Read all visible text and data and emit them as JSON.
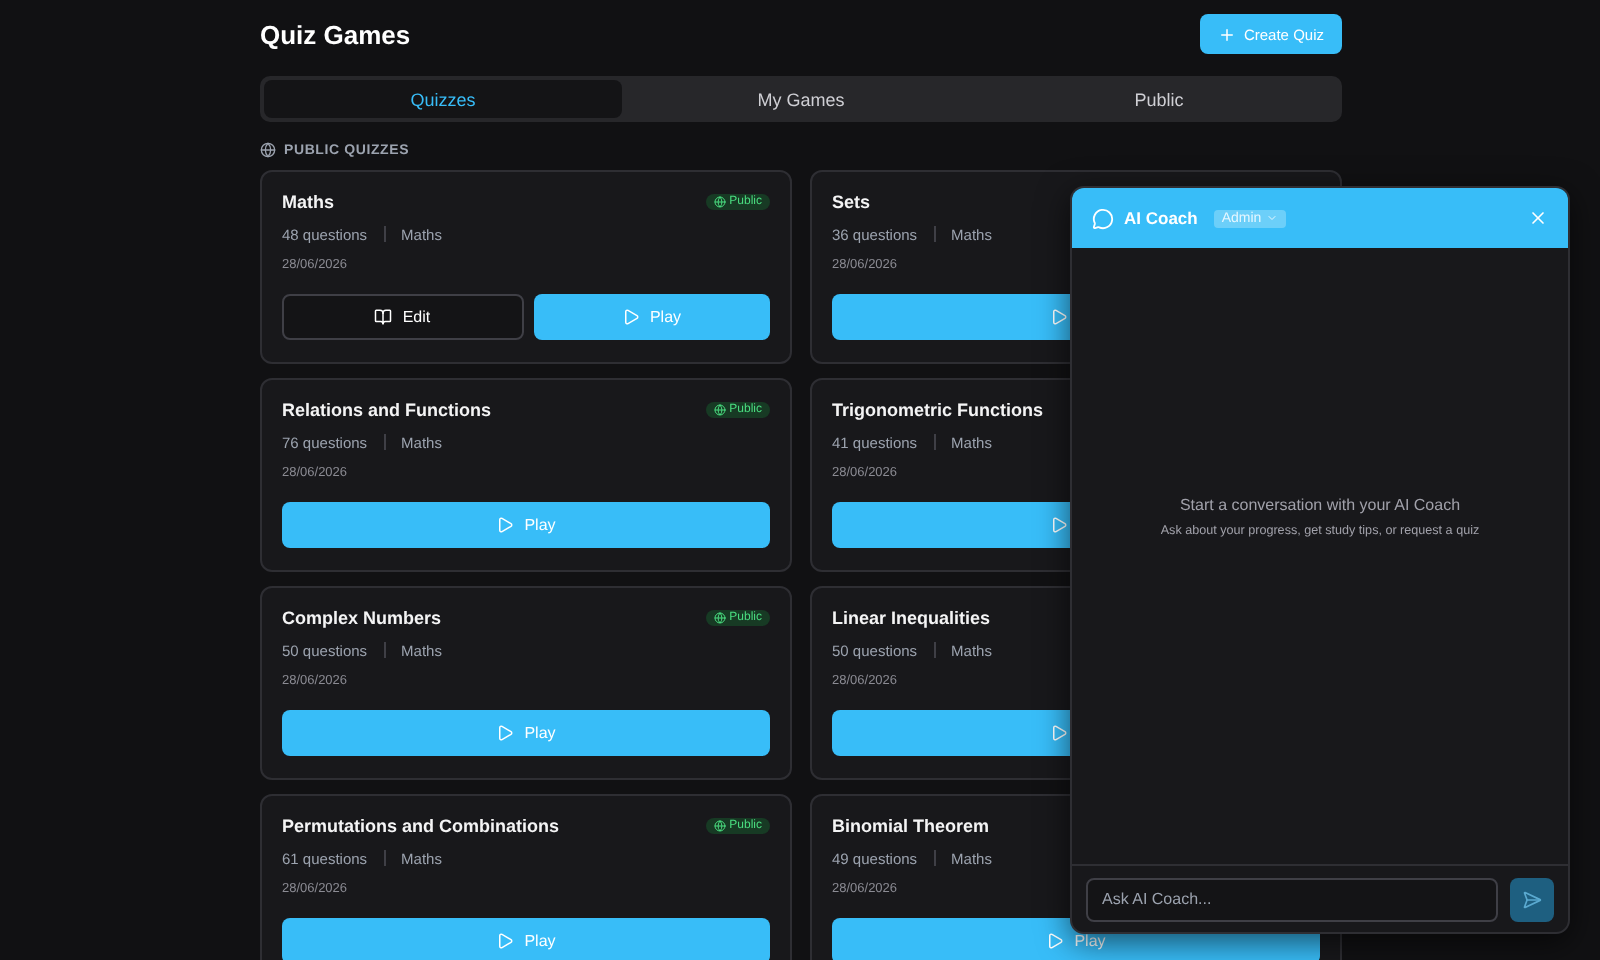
{
  "header": {
    "title": "Quiz Games",
    "create_button": "Create Quiz"
  },
  "tabs": [
    {
      "label": "Quizzes",
      "selected": true
    },
    {
      "label": "My Games",
      "selected": false
    },
    {
      "label": "Public",
      "selected": false
    }
  ],
  "section_label": "PUBLIC QUIZZES",
  "quizzes": [
    {
      "title": "Maths",
      "questions": "48 questions",
      "category": "Maths",
      "date": "28/06/2026",
      "badge": "Public",
      "actions": [
        {
          "kind": "edit",
          "label": "Edit"
        },
        {
          "kind": "play",
          "label": "Play"
        }
      ]
    },
    {
      "title": "Sets",
      "questions": "36 questions",
      "category": "Maths",
      "date": "28/06/2026",
      "actions": [
        {
          "kind": "play"
        }
      ]
    },
    {
      "title": "Relations and Functions",
      "questions": "76 questions",
      "category": "Maths",
      "date": "28/06/2026",
      "badge": "Public",
      "actions": [
        {
          "kind": "play",
          "label": "Play"
        }
      ]
    },
    {
      "title": "Trigonometric Functions",
      "questions": "41 questions",
      "category": "Maths",
      "date": "28/06/2026",
      "actions": [
        {
          "kind": "play"
        }
      ]
    },
    {
      "title": "Complex Numbers",
      "questions": "50 questions",
      "category": "Maths",
      "date": "28/06/2026",
      "badge": "Public",
      "actions": [
        {
          "kind": "play",
          "label": "Play"
        }
      ]
    },
    {
      "title": "Linear Inequalities",
      "questions": "50 questions",
      "category": "Maths",
      "date": "28/06/2026",
      "actions": [
        {
          "kind": "play"
        }
      ]
    },
    {
      "title": "Permutations and Combinations",
      "questions": "61 questions",
      "category": "Maths",
      "date": "28/06/2026",
      "badge": "Public",
      "actions": [
        {
          "kind": "play",
          "label": "Play"
        }
      ]
    },
    {
      "title": "Binomial Theorem",
      "questions": "49 questions",
      "category": "Maths",
      "date": "28/06/2026",
      "actions": [
        {
          "kind": "play",
          "label": "Play"
        }
      ]
    }
  ],
  "chat": {
    "title": "AI Coach",
    "role": "Admin",
    "empty_title": "Start a conversation with your AI Coach",
    "empty_hint": "Ask about your progress, get study tips, or request a quiz",
    "placeholder": "Ask AI Coach..."
  }
}
